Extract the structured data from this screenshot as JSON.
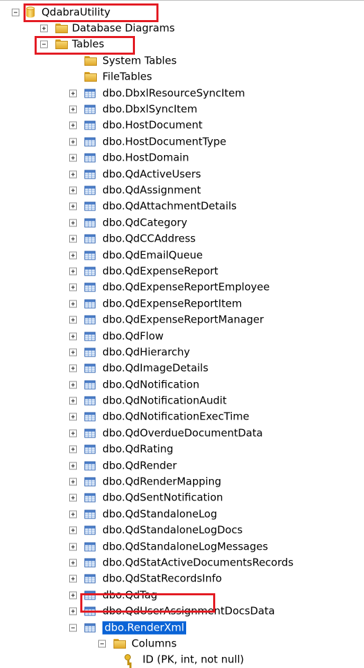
{
  "tree": {
    "root": {
      "label": "QdabraUtility",
      "icon": "database-icon"
    },
    "database_diagrams": {
      "label": "Database Diagrams",
      "icon": "folder-icon"
    },
    "tables_folder": {
      "label": "Tables",
      "icon": "folder-icon"
    },
    "system_tables": {
      "label": "System Tables",
      "icon": "folder-icon"
    },
    "file_tables": {
      "label": "FileTables",
      "icon": "folder-icon"
    },
    "tables": [
      "dbo.DbxlResourceSyncItem",
      "dbo.DbxlSyncItem",
      "dbo.HostDocument",
      "dbo.HostDocumentType",
      "dbo.HostDomain",
      "dbo.QdActiveUsers",
      "dbo.QdAssignment",
      "dbo.QdAttachmentDetails",
      "dbo.QdCategory",
      "dbo.QdCCAddress",
      "dbo.QdEmailQueue",
      "dbo.QdExpenseReport",
      "dbo.QdExpenseReportEmployee",
      "dbo.QdExpenseReportItem",
      "dbo.QdExpenseReportManager",
      "dbo.QdFlow",
      "dbo.QdHierarchy",
      "dbo.QdImageDetails",
      "dbo.QdNotification",
      "dbo.QdNotificationAudit",
      "dbo.QdNotificationExecTime",
      "dbo.QdOverdueDocumentData",
      "dbo.QdRating",
      "dbo.QdRender",
      "dbo.QdRenderMapping",
      "dbo.QdSentNotification",
      "dbo.QdStandaloneLog",
      "dbo.QdStandaloneLogDocs",
      "dbo.QdStandaloneLogMessages",
      "dbo.QdStatActiveDocumentsRecords",
      "dbo.QdStatRecordsInfo",
      "dbo.QdTag",
      "dbo.QdUserAssignmentDocsData"
    ],
    "selected_table": {
      "label": "dbo.RenderXml",
      "icon": "table-icon"
    },
    "columns_folder": {
      "label": "Columns",
      "icon": "folder-icon"
    },
    "column": {
      "label": "ID (PK, int, not null)",
      "icon": "primary-key-icon"
    }
  },
  "colors": {
    "highlight_border": "#e31b23",
    "selection": "#0a63d6",
    "folder": "#e1aa2c",
    "table_icon": "#4c7ec8"
  }
}
